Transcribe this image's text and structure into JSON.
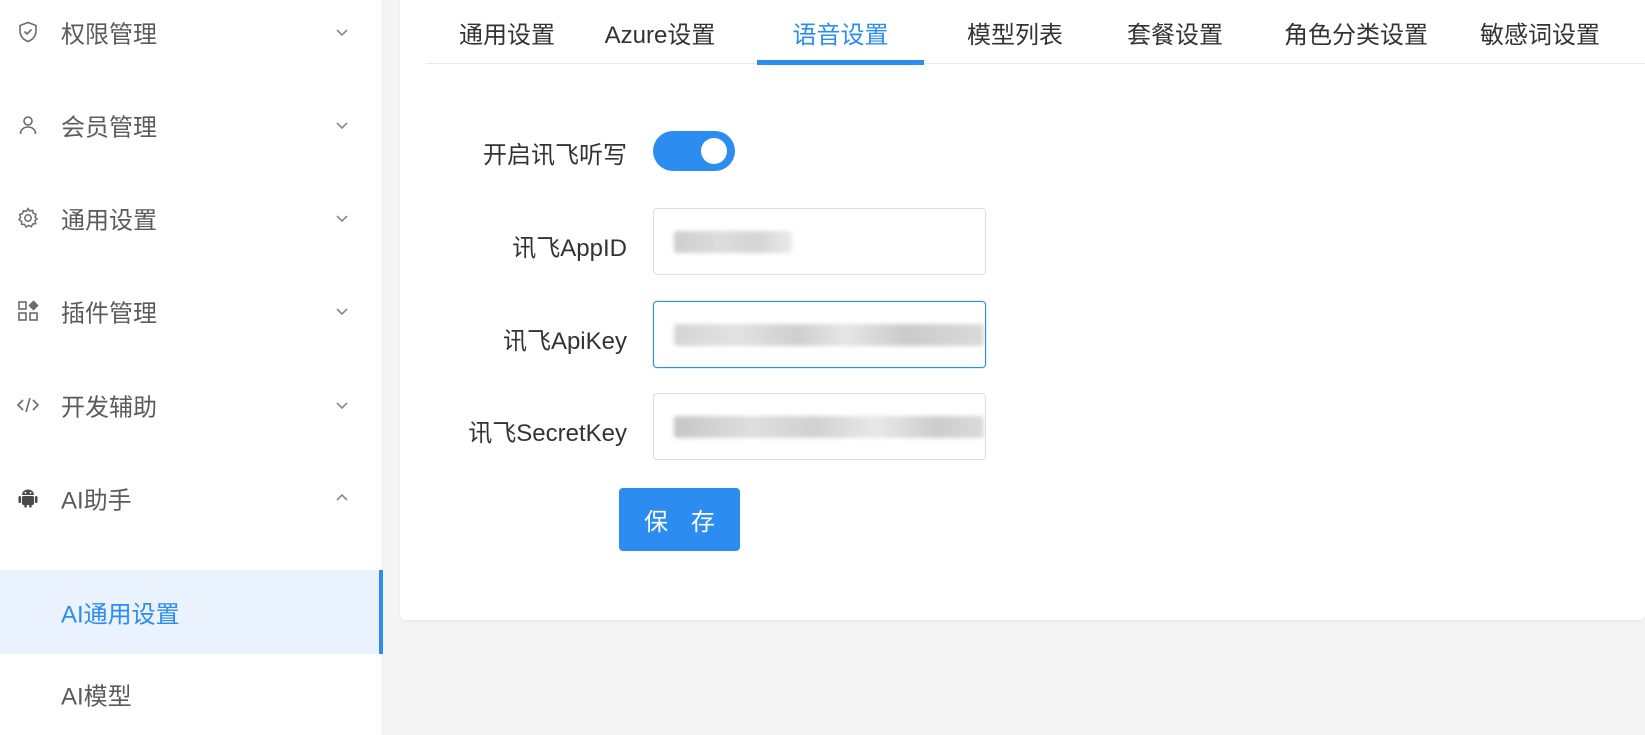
{
  "sidebar": {
    "items": [
      {
        "label": "权限管理",
        "icon": "shield-check-icon",
        "expanded": false
      },
      {
        "label": "会员管理",
        "icon": "user-icon",
        "expanded": false
      },
      {
        "label": "通用设置",
        "icon": "gear-icon",
        "expanded": false
      },
      {
        "label": "插件管理",
        "icon": "apps-plugin-icon",
        "expanded": false
      },
      {
        "label": "开发辅助",
        "icon": "code-icon",
        "expanded": false
      },
      {
        "label": "AI助手",
        "icon": "android-icon",
        "expanded": true
      }
    ],
    "subitems": [
      {
        "label": "AI通用设置",
        "active": true
      },
      {
        "label": "AI模型",
        "active": false
      }
    ]
  },
  "tabs": [
    {
      "label": "通用设置",
      "active": false
    },
    {
      "label": "Azure设置",
      "active": false
    },
    {
      "label": "语音设置",
      "active": true
    },
    {
      "label": "模型列表",
      "active": false
    },
    {
      "label": "套餐设置",
      "active": false
    },
    {
      "label": "角色分类设置",
      "active": false
    },
    {
      "label": "敏感词设置",
      "active": false
    }
  ],
  "form": {
    "enable_label": "开启讯飞听写",
    "enabled": true,
    "appid_label": "讯飞AppID",
    "apikey_label": "讯飞ApiKey",
    "secretkey_label": "讯飞SecretKey",
    "save_label": "保 存"
  },
  "colors": {
    "accent": "#2d8cf0",
    "active_bg": "#e9f2fd",
    "text": "#333333",
    "muted": "#5b5b5b"
  }
}
